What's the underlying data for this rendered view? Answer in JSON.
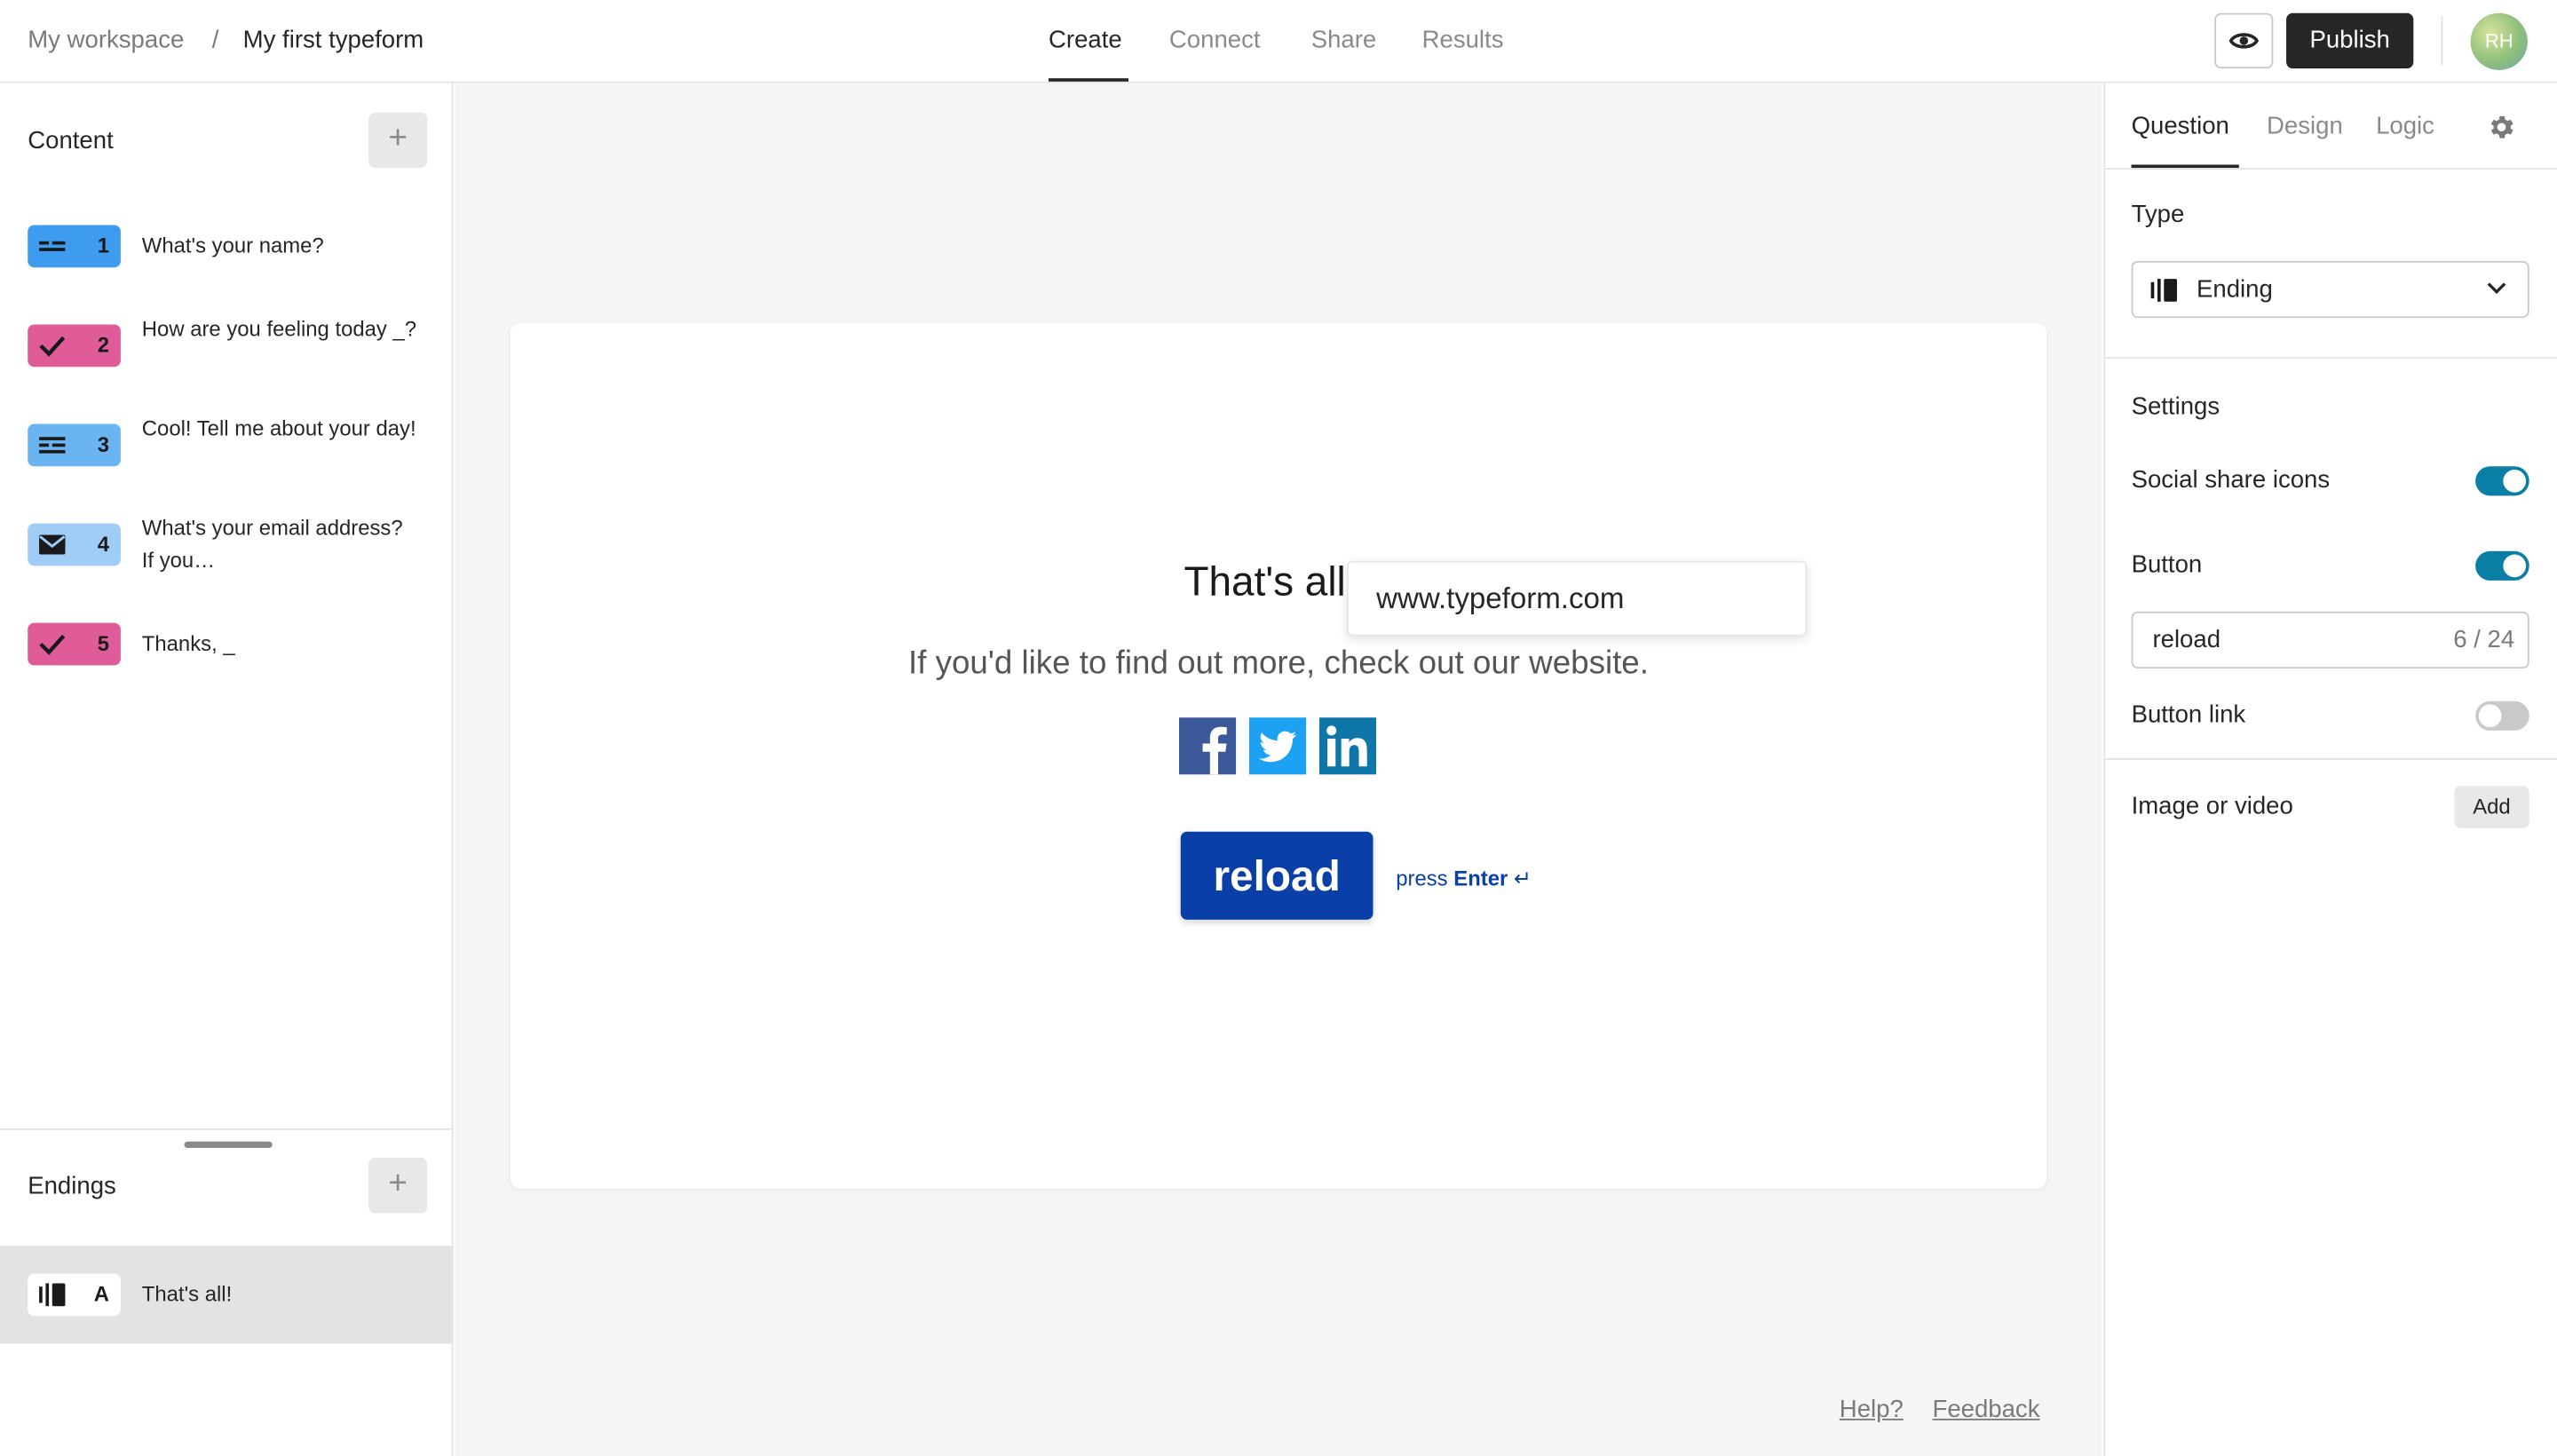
{
  "header": {
    "workspace": "My workspace",
    "separator": "/",
    "form_name": "My first typeform",
    "tabs": [
      "Create",
      "Connect",
      "Share",
      "Results"
    ],
    "active_tab": "Create",
    "publish_label": "Publish",
    "avatar_initials": "RH"
  },
  "content_panel": {
    "title": "Content",
    "add_symbol": "+",
    "questions": [
      {
        "number": "1",
        "text": "What's your name?",
        "color": "#3d9bf0",
        "icon": "short-text-icon"
      },
      {
        "number": "2",
        "text": "How are you feeling today _?",
        "color": "#e05c98",
        "icon": "checkmark-icon"
      },
      {
        "number": "3",
        "text": "Cool! Tell me about your day!",
        "color": "#6bb4f2",
        "icon": "long-text-icon"
      },
      {
        "number": "4",
        "text": "What's your email address? If you…",
        "color": "#9fcdf5",
        "icon": "email-icon"
      },
      {
        "number": "5",
        "text": "Thanks, _",
        "color": "#e05c98",
        "icon": "checkmark-icon"
      }
    ]
  },
  "endings_panel": {
    "title": "Endings",
    "add_symbol": "+",
    "ending": {
      "letter": "A",
      "text": "That's all!",
      "icon": "ending-icon"
    }
  },
  "preview": {
    "title": "That's all",
    "url_tooltip": "www.typeform.com",
    "subtitle": "If you'd like to find out more, check out our website.",
    "social_icons": [
      "facebook-icon",
      "twitter-icon",
      "linkedin-icon"
    ],
    "button_label": "reload",
    "press_text": "press",
    "enter_text": "Enter",
    "enter_symbol": "↵",
    "button_color": "#0a3fa8"
  },
  "footer": {
    "help": "Help?",
    "feedback": "Feedback"
  },
  "settings_panel": {
    "tabs": [
      "Question",
      "Design",
      "Logic"
    ],
    "active_tab": "Question",
    "type_label": "Type",
    "type_value": "Ending",
    "settings_label": "Settings",
    "social_share_label": "Social share icons",
    "social_share_on": true,
    "button_label": "Button",
    "button_on": true,
    "button_text_value": "reload",
    "button_text_count": "6 / 24",
    "button_link_label": "Button link",
    "button_link_on": false,
    "image_video_label": "Image or video",
    "add_label": "Add",
    "toggle_color": "#0a7ea4"
  }
}
